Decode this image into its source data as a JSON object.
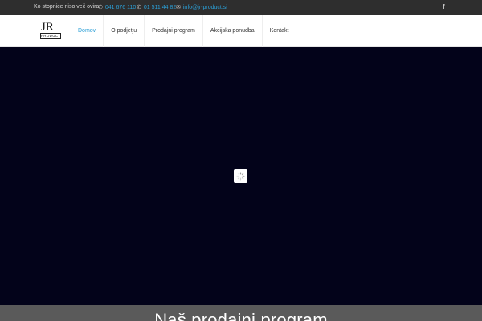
{
  "topbar": {
    "tagline": "Ko stopnice niso več ovira.",
    "phone1": "041 676 110",
    "phone2": "01 511 44 82",
    "email": "info@jr-product.si",
    "social_icon": "facebook-icon",
    "social_glyph": "f"
  },
  "logo": {
    "letters": "JR",
    "sub": "PRODUCT"
  },
  "menu": {
    "items": [
      {
        "label": "Domov"
      },
      {
        "label": "O podjetju"
      },
      {
        "label": "Prodajni program"
      },
      {
        "label": "Akcijska ponudba"
      },
      {
        "label": "Kontakt"
      }
    ]
  },
  "colors": {
    "accent": "#2b9fd6",
    "topbar_bg": "#2e2e2e",
    "slider_bg": "#03031a",
    "band_bg": "#5a5a5a"
  },
  "section": {
    "title": "Naš prodajni program"
  }
}
